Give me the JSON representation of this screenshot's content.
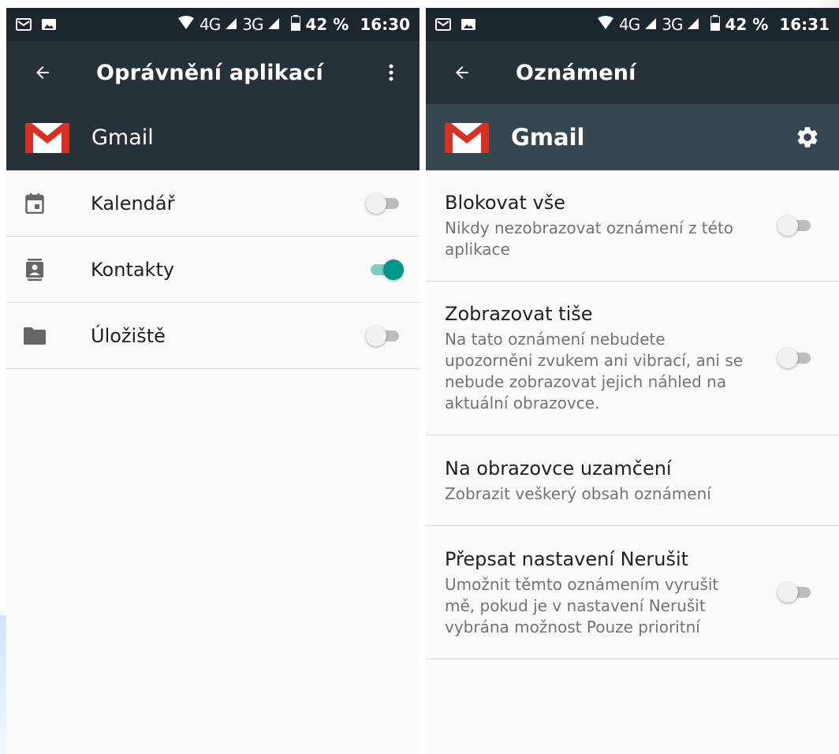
{
  "status_bar": {
    "network": "4G",
    "network2": "3G",
    "battery_percent": "42 %",
    "time_left": "16:30",
    "time_right": "16:31"
  },
  "left_screen": {
    "title": "Oprávnění aplikací",
    "app_name": "Gmail",
    "permissions": [
      {
        "label": "Kalendář",
        "icon": "calendar-icon",
        "enabled": false
      },
      {
        "label": "Kontakty",
        "icon": "contacts-icon",
        "enabled": true
      },
      {
        "label": "Úložiště",
        "icon": "folder-icon",
        "enabled": false
      }
    ]
  },
  "right_screen": {
    "title": "Oznámení",
    "app_name": "Gmail",
    "settings": [
      {
        "title": "Blokovat vše",
        "description": "Nikdy nezobrazovat oznámení z této aplikace",
        "toggle": true,
        "enabled": false
      },
      {
        "title": "Zobrazovat tiše",
        "description": "Na tato oznámení nebudete upozorněni zvukem ani vibrací, ani se nebude zobrazovat jejich náhled na aktuální obrazovce.",
        "toggle": true,
        "enabled": false
      },
      {
        "title": "Na obrazovce uzamčení",
        "description": "Zobrazit veškerý obsah oznámení",
        "toggle": false,
        "enabled": false
      },
      {
        "title": "Přepsat nastavení Nerušit",
        "description": "Umožnit těmto oznámením vyrušit mě, pokud je v nastavení Nerušit vybrána možnost Pouze prioritní",
        "toggle": true,
        "enabled": false
      }
    ]
  },
  "colors": {
    "toolbar": "#263238",
    "statusbar": "#1c262d",
    "app_header_right": "#37474f",
    "accent": "#009688",
    "gmail_red": "#d93025"
  }
}
